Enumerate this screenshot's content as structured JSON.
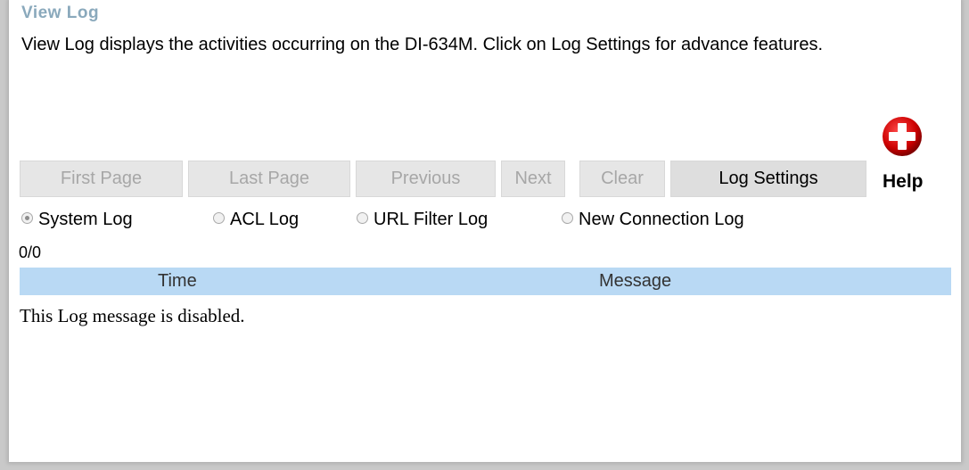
{
  "page": {
    "title": "View Log",
    "description": "View Log displays the activities occurring on the DI-634M. Click on Log Settings for advance features."
  },
  "buttons": {
    "first_page": "First Page",
    "last_page": "Last Page",
    "previous": "Previous",
    "next": "Next",
    "clear": "Clear",
    "log_settings": "Log Settings"
  },
  "help": {
    "label": "Help",
    "icon": "help-plus-icon",
    "color": "#cc0000"
  },
  "log_types": [
    {
      "label": "System Log",
      "checked": true
    },
    {
      "label": "ACL Log",
      "checked": false
    },
    {
      "label": "URL Filter Log",
      "checked": false
    },
    {
      "label": "New Connection Log",
      "checked": false
    }
  ],
  "counter": "0/0",
  "table": {
    "columns": [
      "Time",
      "Message"
    ],
    "header_color": "#b9d9f4",
    "empty_message": "This Log message is disabled."
  }
}
